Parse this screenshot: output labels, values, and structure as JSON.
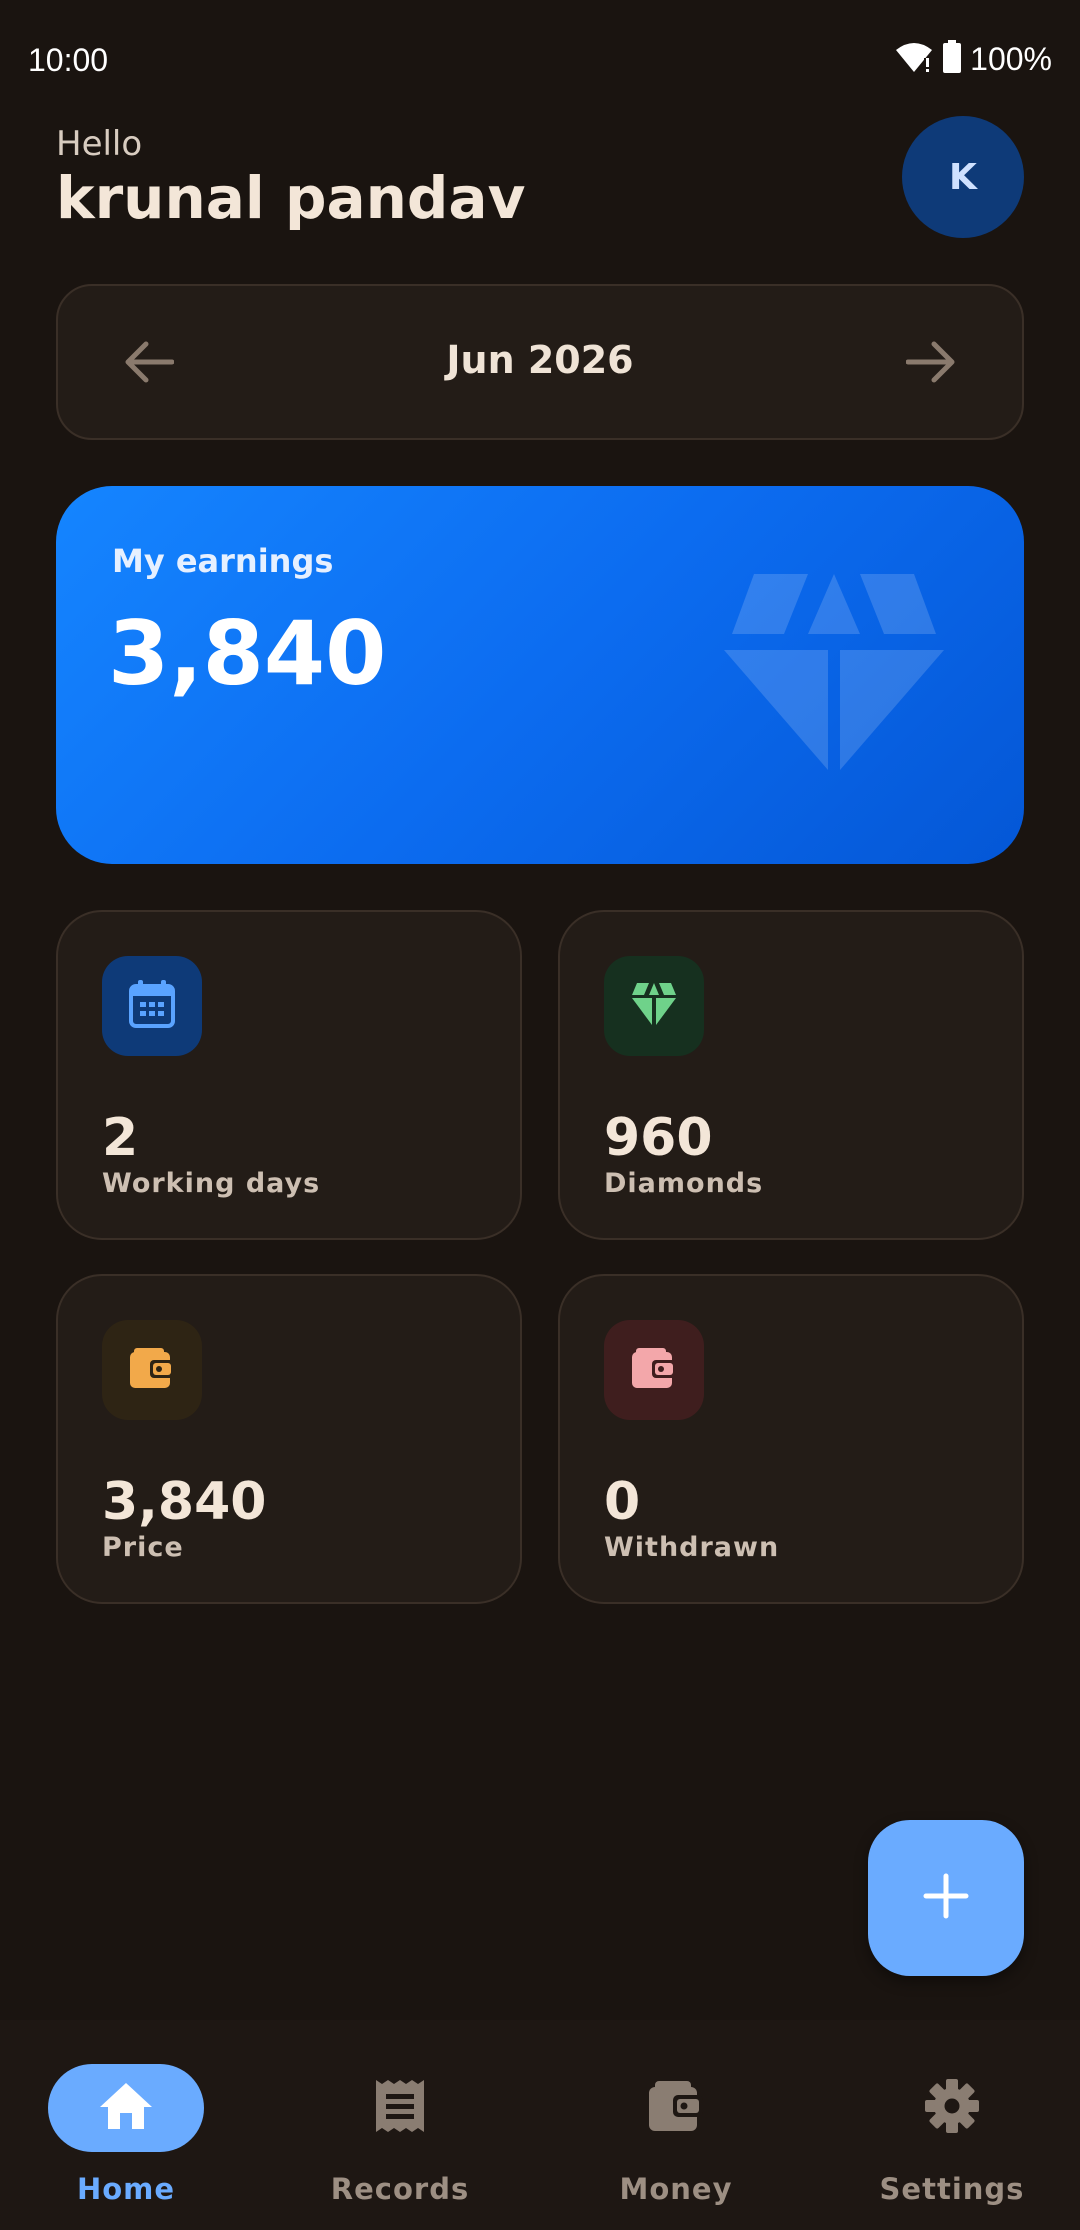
{
  "status_bar": {
    "time": "10:00",
    "battery": "100%"
  },
  "header": {
    "greeting": "Hello",
    "user_name": "krunal pandav",
    "avatar_initial": "K"
  },
  "month_selector": {
    "label": "Jun 2026"
  },
  "earnings": {
    "label": "My earnings",
    "value": "3,840"
  },
  "stats": [
    {
      "value": "2",
      "label": "Working days",
      "icon": "calendar-icon",
      "icon_bg": "#0e3a78",
      "icon_color": "#5aa3ff"
    },
    {
      "value": "960",
      "label": "Diamonds",
      "icon": "diamond-icon",
      "icon_bg": "#16301f",
      "icon_color": "#6fd28a"
    },
    {
      "value": "3,840",
      "label": "Price",
      "icon": "wallet-icon",
      "icon_bg": "#2e2414",
      "icon_color": "#f2a94a"
    },
    {
      "value": "0",
      "label": "Withdrawn",
      "icon": "wallet-icon",
      "icon_bg": "#3f1e1e",
      "icon_color": "#f3a7aa"
    }
  ],
  "fab": {
    "icon": "plus-icon"
  },
  "nav": [
    {
      "label": "Home",
      "icon": "home-icon",
      "active": true
    },
    {
      "label": "Records",
      "icon": "receipt-icon",
      "active": false
    },
    {
      "label": "Money",
      "icon": "wallet-icon",
      "active": false
    },
    {
      "label": "Settings",
      "icon": "gear-icon",
      "active": false
    }
  ],
  "colors": {
    "accent": "#6aabff",
    "background": "#1a1410",
    "card": "#231c17",
    "earnings_gradient_start": "#1585ff",
    "earnings_gradient_end": "#0457d6"
  }
}
